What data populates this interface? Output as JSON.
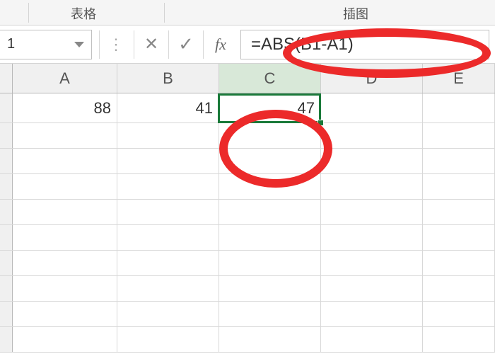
{
  "ribbon": {
    "group_tables": "表格",
    "group_illustrations": "插图"
  },
  "namebox": {
    "value": "1"
  },
  "formula_bar": {
    "fx_label": "fx",
    "content": "=ABS(B1-A1)"
  },
  "columns": [
    "A",
    "B",
    "C",
    "D",
    "E"
  ],
  "cells": {
    "A1": "88",
    "B1": "41",
    "C1": "47"
  },
  "selection": {
    "cell": "C1"
  },
  "annotations": {
    "ellipse_formula": true,
    "ellipse_cell": true
  },
  "colors": {
    "selection_border": "#1a7a3a",
    "annotation_red": "#ec2a2a"
  }
}
